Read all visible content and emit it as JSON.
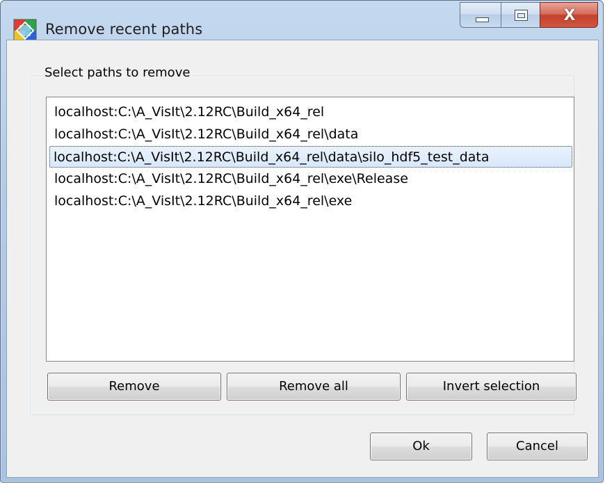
{
  "window": {
    "title": "Remove recent paths",
    "close_glyph": "X"
  },
  "group": {
    "label": "Select paths to remove"
  },
  "paths": [
    {
      "text": "localhost:C:\\A_VisIt\\2.12RC\\Build_x64_rel",
      "selected": false
    },
    {
      "text": "localhost:C:\\A_VisIt\\2.12RC\\Build_x64_rel\\data",
      "selected": false
    },
    {
      "text": "localhost:C:\\A_VisIt\\2.12RC\\Build_x64_rel\\data\\silo_hdf5_test_data",
      "selected": true
    },
    {
      "text": "localhost:C:\\A_VisIt\\2.12RC\\Build_x64_rel\\exe\\Release",
      "selected": false
    },
    {
      "text": "localhost:C:\\A_VisIt\\2.12RC\\Build_x64_rel\\exe",
      "selected": false
    }
  ],
  "buttons": {
    "remove": "Remove",
    "remove_all": "Remove all",
    "invert": "Invert selection",
    "ok": "Ok",
    "cancel": "Cancel"
  },
  "icons": {
    "app": "visit-app-icon",
    "minimize": "minimize-icon",
    "maximize": "maximize-icon",
    "close": "close-icon"
  },
  "colors": {
    "selection_fill": "#d7e8fb",
    "close_button": "#c3412c",
    "titlebar": "#b4cbe6"
  }
}
